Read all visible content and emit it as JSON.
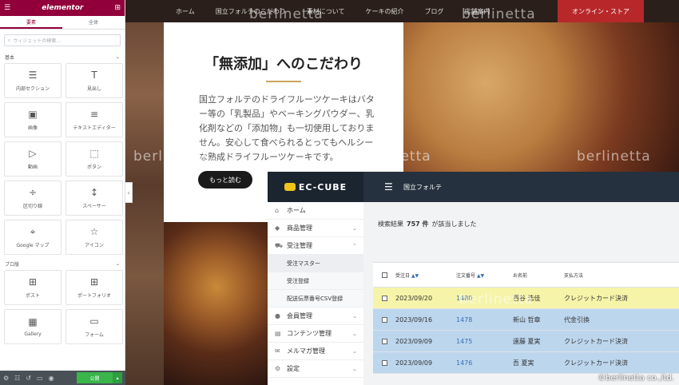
{
  "site": {
    "nav": [
      "ホーム",
      "国立フォルテのこだわり",
      "素材について",
      "ケーキの紹介",
      "ブログ",
      "店舗案内"
    ],
    "store_button": "オンライン・ストア",
    "hero": {
      "title": "「無添加」へのこだわり",
      "body": "国立フォルテのドライフルーツケーキはバター等の「乳製品」やベーキングパウダー、乳化剤などの「添加物」も一切使用しておりません。安心して食べられるとってもヘルシーな熟成ドライフルーツケーキです。",
      "button": "もっと読む"
    },
    "watermark": "berlinetta",
    "credit": "©berlinetta co.,ltd."
  },
  "elementor": {
    "logo": "elementor",
    "tabs": [
      "要素",
      "全体"
    ],
    "search_placeholder": "ウィジェットの検索…",
    "sections": [
      {
        "title": "基本",
        "widgets": [
          {
            "label": "内部セクション",
            "icon": "inner-section-icon"
          },
          {
            "label": "見出し",
            "icon": "heading-icon"
          },
          {
            "label": "画像",
            "icon": "image-icon"
          },
          {
            "label": "テキストエディター",
            "icon": "text-editor-icon"
          },
          {
            "label": "動画",
            "icon": "video-icon"
          },
          {
            "label": "ボタン",
            "icon": "button-icon"
          },
          {
            "label": "区切り線",
            "icon": "divider-icon"
          },
          {
            "label": "スペーサー",
            "icon": "spacer-icon"
          },
          {
            "label": "Google マップ",
            "icon": "google-maps-icon"
          },
          {
            "label": "アイコン",
            "icon": "star-icon"
          }
        ]
      },
      {
        "title": "プロ版",
        "widgets": [
          {
            "label": "ポスト",
            "icon": "posts-icon"
          },
          {
            "label": "ポートフォリオ",
            "icon": "portfolio-icon"
          },
          {
            "label": "Gallery",
            "icon": "gallery-icon"
          },
          {
            "label": "フォーム",
            "icon": "form-icon"
          }
        ]
      }
    ],
    "publish": "公開"
  },
  "eccube": {
    "logo": "EC-CUBE",
    "shop_name": "国立フォルテ",
    "menu": {
      "home": "ホーム",
      "products": "商品管理",
      "orders": "受注管理",
      "orders_sub": [
        "受注マスター",
        "受注登録",
        "配送伝票番号CSV登録"
      ],
      "members": "会員管理",
      "contents": "コンテンツ管理",
      "mailmag": "メルマガ管理",
      "settings": "設定"
    },
    "result": {
      "label": "検索結果",
      "count": "757 件",
      "suffix": "が該当しました"
    },
    "table": {
      "headers": [
        "受注日",
        "注文番号",
        "お名前",
        "支払方法"
      ],
      "rows": [
        {
          "date": "2023/09/20",
          "no": "1480",
          "name": "西谷 浩佳",
          "pay": "クレジットカード決済"
        },
        {
          "date": "2023/09/16",
          "no": "1478",
          "name": "新山 哲章",
          "pay": "代金引換"
        },
        {
          "date": "2023/09/09",
          "no": "1475",
          "name": "遠藤 夏実",
          "pay": "クレジットカード決済"
        },
        {
          "date": "2023/09/09",
          "no": "1476",
          "name": "吾 夏実",
          "pay": "クレジットカード決済"
        }
      ]
    }
  }
}
